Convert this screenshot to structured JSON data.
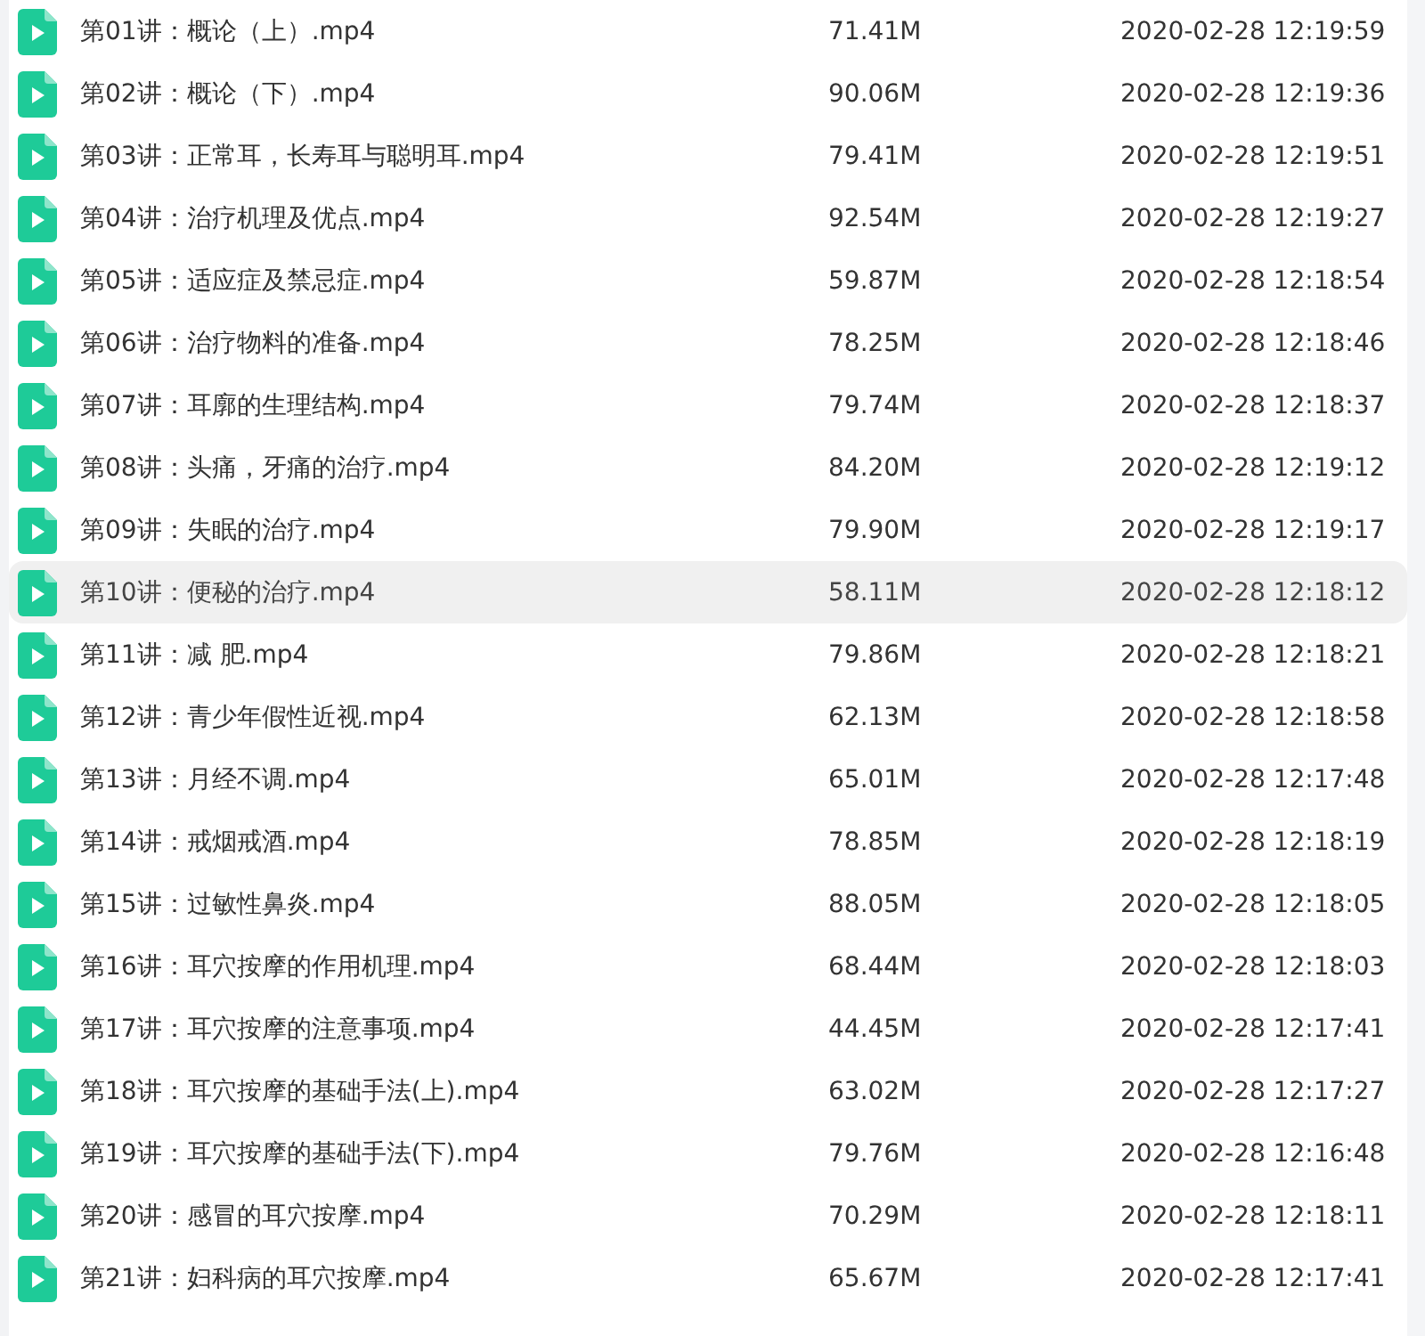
{
  "files": [
    {
      "name": "第01讲：概论（上）.mp4",
      "size": "71.41M",
      "modified": "2020-02-28 12:19:59",
      "selected": false
    },
    {
      "name": "第02讲：概论（下）.mp4",
      "size": "90.06M",
      "modified": "2020-02-28 12:19:36",
      "selected": false
    },
    {
      "name": "第03讲：正常耳，长寿耳与聪明耳.mp4",
      "size": "79.41M",
      "modified": "2020-02-28 12:19:51",
      "selected": false
    },
    {
      "name": "第04讲：治疗机理及优点.mp4",
      "size": "92.54M",
      "modified": "2020-02-28 12:19:27",
      "selected": false
    },
    {
      "name": "第05讲：适应症及禁忌症.mp4",
      "size": "59.87M",
      "modified": "2020-02-28 12:18:54",
      "selected": false
    },
    {
      "name": "第06讲：治疗物料的准备.mp4",
      "size": "78.25M",
      "modified": "2020-02-28 12:18:46",
      "selected": false
    },
    {
      "name": "第07讲：耳廓的生理结构.mp4",
      "size": "79.74M",
      "modified": "2020-02-28 12:18:37",
      "selected": false
    },
    {
      "name": "第08讲：头痛，牙痛的治疗.mp4",
      "size": "84.20M",
      "modified": "2020-02-28 12:19:12",
      "selected": false
    },
    {
      "name": "第09讲：失眠的治疗.mp4",
      "size": "79.90M",
      "modified": "2020-02-28 12:19:17",
      "selected": false
    },
    {
      "name": "第10讲：便秘的治疗.mp4",
      "size": "58.11M",
      "modified": "2020-02-28 12:18:12",
      "selected": true
    },
    {
      "name": "第11讲：减 肥.mp4",
      "size": "79.86M",
      "modified": "2020-02-28 12:18:21",
      "selected": false
    },
    {
      "name": "第12讲：青少年假性近视.mp4",
      "size": "62.13M",
      "modified": "2020-02-28 12:18:58",
      "selected": false
    },
    {
      "name": "第13讲：月经不调.mp4",
      "size": "65.01M",
      "modified": "2020-02-28 12:17:48",
      "selected": false
    },
    {
      "name": "第14讲：戒烟戒酒.mp4",
      "size": "78.85M",
      "modified": "2020-02-28 12:18:19",
      "selected": false
    },
    {
      "name": "第15讲：过敏性鼻炎.mp4",
      "size": "88.05M",
      "modified": "2020-02-28 12:18:05",
      "selected": false
    },
    {
      "name": "第16讲：耳穴按摩的作用机理.mp4",
      "size": "68.44M",
      "modified": "2020-02-28 12:18:03",
      "selected": false
    },
    {
      "name": "第17讲：耳穴按摩的注意事项.mp4",
      "size": "44.45M",
      "modified": "2020-02-28 12:17:41",
      "selected": false
    },
    {
      "name": "第18讲：耳穴按摩的基础手法(上).mp4",
      "size": "63.02M",
      "modified": "2020-02-28 12:17:27",
      "selected": false
    },
    {
      "name": "第19讲：耳穴按摩的基础手法(下).mp4",
      "size": "79.76M",
      "modified": "2020-02-28 12:16:48",
      "selected": false
    },
    {
      "name": "第20讲：感冒的耳穴按摩.mp4",
      "size": "70.29M",
      "modified": "2020-02-28 12:18:11",
      "selected": false
    },
    {
      "name": "第21讲：妇科病的耳穴按摩.mp4",
      "size": "65.67M",
      "modified": "2020-02-28 12:17:41",
      "selected": false
    }
  ]
}
